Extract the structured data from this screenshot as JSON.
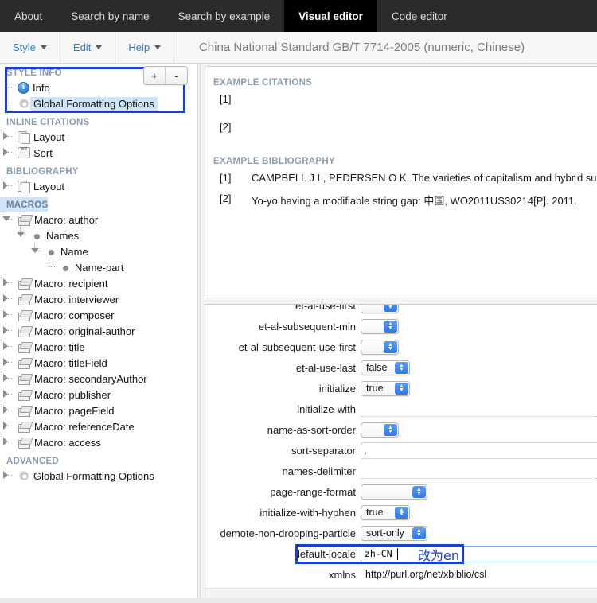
{
  "topnav": {
    "tabs": [
      {
        "label": "About",
        "active": false
      },
      {
        "label": "Search by name",
        "active": false
      },
      {
        "label": "Search by example",
        "active": false
      },
      {
        "label": "Visual editor",
        "active": true
      },
      {
        "label": "Code editor",
        "active": false
      }
    ]
  },
  "menubar": {
    "items": [
      "Style",
      "Edit",
      "Help"
    ],
    "style_title": "China National Standard GB/T 7714-2005 (numeric, Chinese)"
  },
  "sidebar": {
    "plus_label": "+",
    "minus_label": "-",
    "sections": [
      {
        "heading": "STYLE INFO",
        "highlighted_heading": false,
        "items": [
          {
            "label": "Info",
            "icon": "info-icon",
            "depth": 1,
            "selected": false,
            "handle": "leaf"
          },
          {
            "label": "Global Formatting Options",
            "icon": "gear-icon",
            "depth": 1,
            "selected": true,
            "handle": "last"
          }
        ]
      },
      {
        "heading": "INLINE CITATIONS",
        "highlighted_heading": false,
        "items": [
          {
            "label": "Layout",
            "icon": "pages-icon",
            "depth": 1,
            "selected": false,
            "handle": "closed"
          },
          {
            "label": "Sort",
            "icon": "sort-icon",
            "depth": 1,
            "selected": false,
            "handle": "closed"
          }
        ]
      },
      {
        "heading": "BIBLIOGRAPHY",
        "highlighted_heading": false,
        "items": [
          {
            "label": "Layout",
            "icon": "pages-icon",
            "depth": 1,
            "selected": false,
            "handle": "closed"
          }
        ]
      },
      {
        "heading": "MACROS",
        "highlighted_heading": true,
        "items": [
          {
            "label": "Macro: author",
            "icon": "cube-icon",
            "depth": 1,
            "selected": false,
            "handle": "open"
          },
          {
            "label": "Names",
            "icon": "dot-icon",
            "depth": 2,
            "selected": false,
            "handle": "open"
          },
          {
            "label": "Name",
            "icon": "dot-icon",
            "depth": 3,
            "selected": false,
            "handle": "open"
          },
          {
            "label": "Name-part",
            "icon": "dot-icon",
            "depth": 4,
            "selected": false,
            "handle": "last"
          },
          {
            "label": "Macro: recipient",
            "icon": "cube-icon",
            "depth": 1,
            "selected": false,
            "handle": "closed"
          },
          {
            "label": "Macro: interviewer",
            "icon": "cube-icon",
            "depth": 1,
            "selected": false,
            "handle": "closed"
          },
          {
            "label": "Macro: composer",
            "icon": "cube-icon",
            "depth": 1,
            "selected": false,
            "handle": "closed"
          },
          {
            "label": "Macro: original-author",
            "icon": "cube-icon",
            "depth": 1,
            "selected": false,
            "handle": "closed"
          },
          {
            "label": "Macro: title",
            "icon": "cube-icon",
            "depth": 1,
            "selected": false,
            "handle": "closed"
          },
          {
            "label": "Macro: titleField",
            "icon": "cube-icon",
            "depth": 1,
            "selected": false,
            "handle": "closed"
          },
          {
            "label": "Macro: secondaryAuthor",
            "icon": "cube-icon",
            "depth": 1,
            "selected": false,
            "handle": "closed"
          },
          {
            "label": "Macro: publisher",
            "icon": "cube-icon",
            "depth": 1,
            "selected": false,
            "handle": "closed"
          },
          {
            "label": "Macro: pageField",
            "icon": "cube-icon",
            "depth": 1,
            "selected": false,
            "handle": "closed"
          },
          {
            "label": "Macro: referenceDate",
            "icon": "cube-icon",
            "depth": 1,
            "selected": false,
            "handle": "closed"
          },
          {
            "label": "Macro: access",
            "icon": "cube-icon",
            "depth": 1,
            "selected": false,
            "handle": "closed"
          }
        ]
      },
      {
        "heading": "ADVANCED",
        "highlighted_heading": false,
        "items": [
          {
            "label": "Global Formatting Options",
            "icon": "gear-icon",
            "depth": 1,
            "selected": false,
            "handle": "closed"
          }
        ]
      }
    ]
  },
  "examples": {
    "citations_heading": "EXAMPLE CITATIONS",
    "citations": [
      {
        "num": "[1]",
        "text": ""
      },
      {
        "num": "[2]",
        "text": ""
      }
    ],
    "bibliography_heading": "EXAMPLE BIBLIOGRAPHY",
    "bibliography": [
      {
        "num": "[1]",
        "text": "CAMPBELL J L, PEDERSEN O K. The varieties of capitalism and hybrid suc"
      },
      {
        "num": "[2]",
        "text": "Yo-yo having a modifiable string gap: 中国, WO2011US30214[P]. 2011."
      }
    ]
  },
  "editor": {
    "fields": [
      {
        "name": "et-al-use-first",
        "type": "select",
        "value": "",
        "width": "blank"
      },
      {
        "name": "et-al-subsequent-min",
        "type": "select",
        "value": "",
        "width": "blank"
      },
      {
        "name": "et-al-subsequent-use-first",
        "type": "select",
        "value": "",
        "width": "blank"
      },
      {
        "name": "et-al-use-last",
        "type": "select",
        "value": "false",
        "width": "mid"
      },
      {
        "name": "initialize",
        "type": "select",
        "value": "true",
        "width": "mid"
      },
      {
        "name": "initialize-with",
        "type": "text",
        "value": ""
      },
      {
        "name": "name-as-sort-order",
        "type": "select",
        "value": "",
        "width": "blank"
      },
      {
        "name": "sort-separator",
        "type": "text",
        "value": ","
      },
      {
        "name": "names-delimiter",
        "type": "text",
        "value": ""
      },
      {
        "name": "page-range-format",
        "type": "select",
        "value": "",
        "width": "wide"
      },
      {
        "name": "initialize-with-hyphen",
        "type": "select",
        "value": "true",
        "width": "mid"
      },
      {
        "name": "demote-non-dropping-particle",
        "type": "select",
        "value": "sort-only",
        "width": "wide"
      }
    ],
    "locale": {
      "label": "default-locale",
      "value": "zh-CN",
      "annotation": "改为en"
    },
    "xmlns": {
      "label": "xmlns",
      "value": "http://purl.org/net/xbiblio/csl"
    }
  },
  "colors": {
    "accent_blue": "#2f7fd1",
    "annotation_blue": "#1a3fd0",
    "selection_blue": "#cfe4f7",
    "section_header": "#8a9bb0",
    "nav_bg": "#2b2b2b",
    "active_tab_bg": "#000000"
  }
}
